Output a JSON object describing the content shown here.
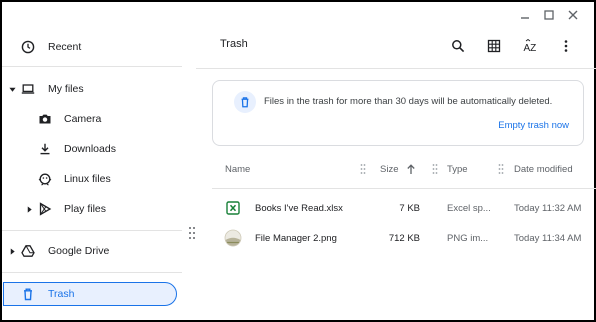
{
  "window": {
    "controls": [
      "minimize",
      "maximize",
      "close"
    ]
  },
  "sidebar": {
    "items": [
      {
        "label": "Recent",
        "icon": "clock-icon"
      },
      {
        "label": "My files",
        "icon": "laptop-icon"
      },
      {
        "label": "Camera",
        "icon": "camera-icon"
      },
      {
        "label": "Downloads",
        "icon": "download-icon"
      },
      {
        "label": "Linux files",
        "icon": "linux-penguin-icon"
      },
      {
        "label": "Play files",
        "icon": "play-store-icon"
      },
      {
        "label": "Google Drive",
        "icon": "google-drive-icon"
      },
      {
        "label": "Trash",
        "icon": "trash-icon",
        "selected": true
      }
    ]
  },
  "header": {
    "title": "Trash",
    "actions": [
      "search-icon",
      "grid-view-icon",
      "sort-az-icon",
      "more-vertical-icon"
    ]
  },
  "banner": {
    "message": "Files in the trash for more than 30 days will be automatically deleted.",
    "action_label": "Empty trash now"
  },
  "table": {
    "columns": [
      "Name",
      "Size",
      "Type",
      "Date modified"
    ],
    "rows": [
      {
        "name": "Books I've Read.xlsx",
        "size": "7 KB",
        "type": "Excel sp...",
        "date": "Today 11:32 AM",
        "icon": "excel-file-icon"
      },
      {
        "name": "File Manager 2.png",
        "size": "712 KB",
        "type": "PNG im...",
        "date": "Today 11:34 AM",
        "icon": "image-thumbnail-icon"
      }
    ]
  },
  "colors": {
    "accent": "#1a73e8",
    "selected_bg": "#e8f0fe",
    "excel_green": "#188038"
  }
}
